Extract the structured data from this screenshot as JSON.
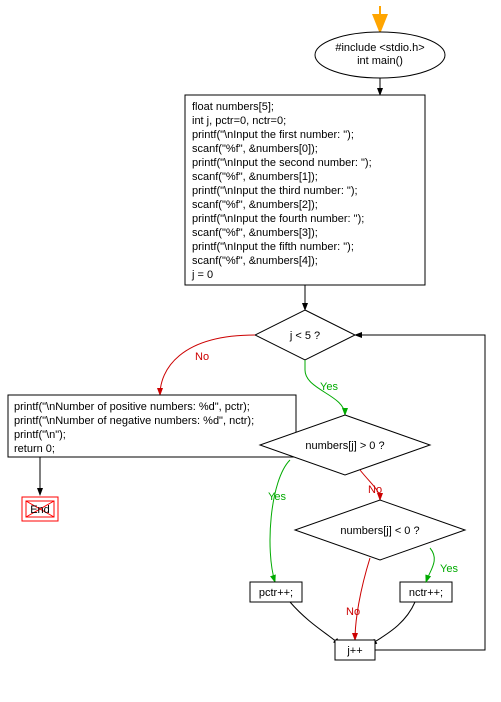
{
  "chart_data": {
    "type": "flowchart",
    "nodes": [
      {
        "id": "start_arrow",
        "type": "start"
      },
      {
        "id": "header",
        "type": "terminator",
        "lines": [
          "#include <stdio.h>",
          "int main()"
        ]
      },
      {
        "id": "decl",
        "type": "process",
        "lines": [
          "float numbers[5];",
          "int j, pctr=0, nctr=0;",
          "printf(\"\\nInput the first number: \");",
          "scanf(\"%f\", &numbers[0]);",
          "printf(\"\\nInput the second number: \");",
          "scanf(\"%f\", &numbers[1]);",
          "printf(\"\\nInput the third number: \");",
          "scanf(\"%f\", &numbers[2]);",
          "printf(\"\\nInput the fourth number: \");",
          "scanf(\"%f\", &numbers[3]);",
          "printf(\"\\nInput the fifth number: \");",
          "scanf(\"%f\", &numbers[4]);",
          "j = 0"
        ]
      },
      {
        "id": "cond_j",
        "type": "decision",
        "text": "j < 5 ?"
      },
      {
        "id": "output",
        "type": "process",
        "lines": [
          "printf(\"\\nNumber of positive numbers: %d\", pctr);",
          "printf(\"\\nNumber of negative numbers: %d\", nctr);",
          "printf(\"\\n\");",
          "return 0;"
        ]
      },
      {
        "id": "end",
        "type": "end",
        "text": "End"
      },
      {
        "id": "cond_pos",
        "type": "decision",
        "text": "numbers[j] > 0 ?"
      },
      {
        "id": "cond_neg",
        "type": "decision",
        "text": "numbers[j] < 0 ?"
      },
      {
        "id": "pctr",
        "type": "process",
        "text": "pctr++;"
      },
      {
        "id": "nctr",
        "type": "process",
        "text": "nctr++;"
      },
      {
        "id": "jpp",
        "type": "process",
        "text": "j++"
      }
    ],
    "edges": [
      {
        "from": "start_arrow",
        "to": "header"
      },
      {
        "from": "header",
        "to": "decl"
      },
      {
        "from": "decl",
        "to": "cond_j"
      },
      {
        "from": "cond_j",
        "to": "output",
        "label": "No"
      },
      {
        "from": "cond_j",
        "to": "cond_pos",
        "label": "Yes"
      },
      {
        "from": "output",
        "to": "end"
      },
      {
        "from": "cond_pos",
        "to": "pctr",
        "label": "Yes"
      },
      {
        "from": "cond_pos",
        "to": "cond_neg",
        "label": "No"
      },
      {
        "from": "cond_neg",
        "to": "nctr",
        "label": "Yes"
      },
      {
        "from": "cond_neg",
        "to": "jpp",
        "label": "No"
      },
      {
        "from": "pctr",
        "to": "jpp"
      },
      {
        "from": "nctr",
        "to": "jpp"
      },
      {
        "from": "jpp",
        "to": "cond_j"
      }
    ],
    "labels": {
      "yes": "Yes",
      "no": "No"
    }
  }
}
